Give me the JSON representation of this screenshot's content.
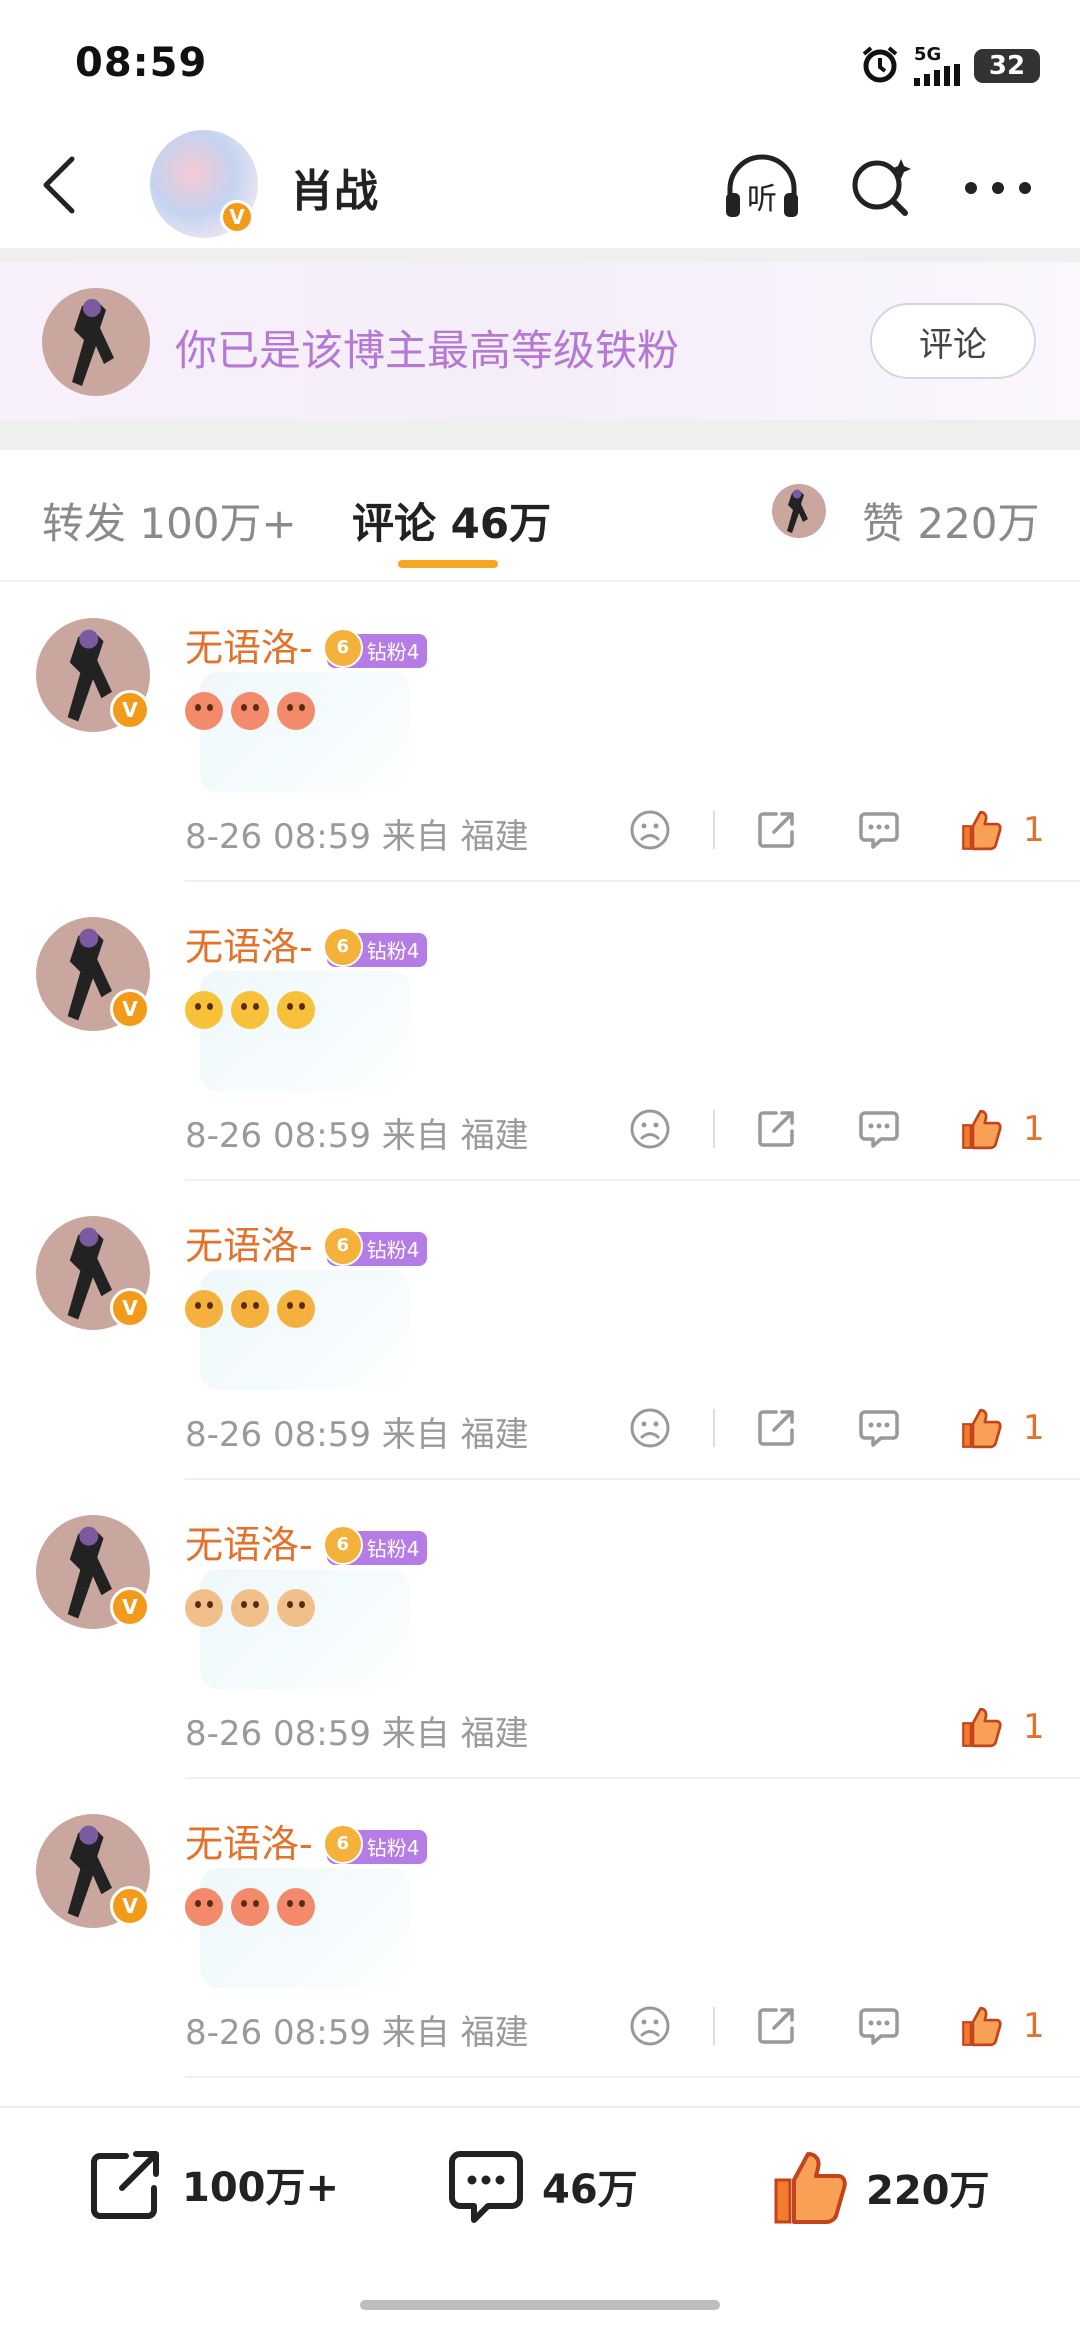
{
  "status_bar": {
    "time": "08:59",
    "network": "5G",
    "battery": "32"
  },
  "header": {
    "title": "肖战",
    "verified_mark": "V",
    "listen_label": "听"
  },
  "fan_banner": {
    "text": "你已是该博主最高等级铁粉",
    "button_label": "评论"
  },
  "tabs": [
    {
      "label": "转发 100万+",
      "active": false
    },
    {
      "label": "评论 46万",
      "active": true
    },
    {
      "label": "赞 220万",
      "active": false
    }
  ],
  "comments": [
    {
      "username": "无语洛-",
      "badge_level": "6",
      "badge_text": "钻粉4",
      "emoji": "smile",
      "time": "8-26 08:59",
      "location": "来自 福建",
      "likes": "1"
    },
    {
      "username": "无语洛-",
      "badge_level": "6",
      "badge_text": "钻粉4",
      "emoji": "shock",
      "time": "8-26 08:59",
      "location": "来自 福建",
      "likes": "1"
    },
    {
      "username": "无语洛-",
      "badge_level": "6",
      "badge_text": "钻粉4",
      "emoji": "cry",
      "time": "8-26 08:59",
      "location": "来自 福建",
      "likes": "1"
    },
    {
      "username": "无语洛-",
      "badge_level": "6",
      "badge_text": "钻粉4",
      "emoji": "hands",
      "time": "8-26 08:59",
      "location": "来自 福建",
      "likes": "1"
    },
    {
      "username": "无语洛-",
      "badge_level": "6",
      "badge_text": "钻粉4",
      "emoji": "smile",
      "time": "8-26 08:59",
      "location": "来自 福建",
      "likes": "1"
    }
  ],
  "bottom_bar": {
    "repost_count": "100万+",
    "comment_count": "46万",
    "like_count": "220万"
  },
  "colors": {
    "accent_orange": "#e2732d",
    "tab_underline": "#f5a623",
    "fan_text": "#b678d4",
    "badge_purple": "#b67ce6",
    "verified_orange": "#f29b1a"
  }
}
